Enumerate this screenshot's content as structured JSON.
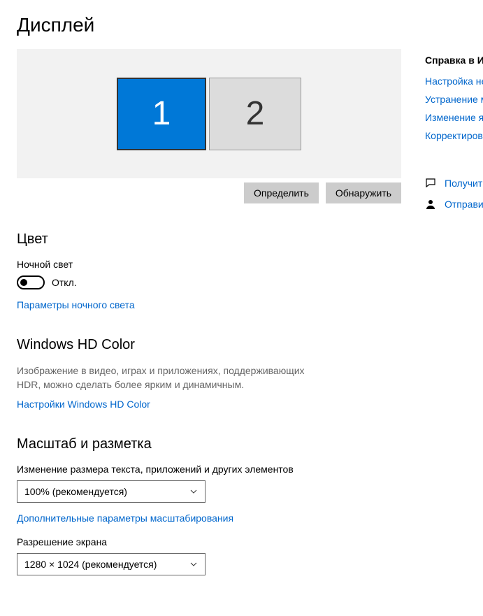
{
  "page": {
    "title": "Дисплей"
  },
  "monitors": {
    "m1": "1",
    "m2": "2"
  },
  "buttons": {
    "identify": "Определить",
    "detect": "Обнаружить"
  },
  "color": {
    "heading": "Цвет",
    "night_light_label": "Ночной свет",
    "toggle_state": "Откл.",
    "night_light_settings": "Параметры ночного света"
  },
  "hd": {
    "heading": "Windows HD Color",
    "desc": "Изображение в видео, играх и приложениях, поддерживающих HDR, можно сделать более ярким и динамичным.",
    "link": "Настройки Windows HD Color"
  },
  "scale": {
    "heading": "Масштаб и разметка",
    "text_size_label": "Изменение размера текста, приложений и других элементов",
    "text_size_value": "100% (рекомендуется)",
    "advanced_link": "Дополнительные параметры масштабирования",
    "resolution_label": "Разрешение экрана",
    "resolution_value": "1280 × 1024 (рекомендуется)"
  },
  "sidebar": {
    "heading": "Справка в Инт",
    "links": [
      "Настройка нес",
      "Устранение ме",
      "Изменение яр",
      "Корректировк"
    ],
    "help": "Получить",
    "feedback": "Отправит"
  }
}
